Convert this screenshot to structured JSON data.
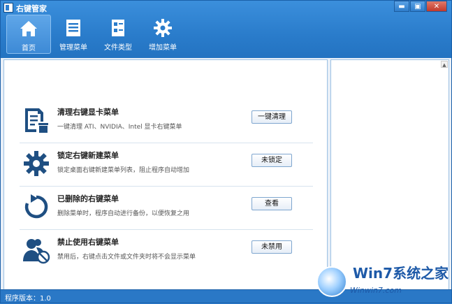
{
  "window": {
    "title": "右键管家",
    "min": "▬",
    "max": "▣",
    "close": "✕"
  },
  "nav": [
    {
      "label": "首页",
      "icon": "home-icon"
    },
    {
      "label": "管理菜单",
      "icon": "list-icon"
    },
    {
      "label": "文件类型",
      "icon": "file-type-icon"
    },
    {
      "label": "增加菜单",
      "icon": "gear-icon"
    }
  ],
  "rows": [
    {
      "title": "清理右键显卡菜单",
      "desc": "一键清理 ATI、NVIDIA、Intel 显卡右键菜单",
      "button": "一键清理",
      "icon": "clean-document-icon"
    },
    {
      "title": "锁定右键新建菜单",
      "desc": "锁定桌面右键新建菜单列表，阻止程序自动增加",
      "button": "未锁定",
      "icon": "gear-icon"
    },
    {
      "title": "已删除的右键菜单",
      "desc": "删除菜单时，程序自动进行备份，以便恢复之用",
      "button": "查看",
      "icon": "restore-arrow-icon"
    },
    {
      "title": "禁止使用右键菜单",
      "desc": "禁用后，右键点击文件或文件夹时将不会显示菜单",
      "button": "未禁用",
      "icon": "user-disabled-icon"
    }
  ],
  "status": {
    "version": "程序版本：1.0"
  },
  "watermark": {
    "line1": "Win7系统之家",
    "line2": "Winwin7.com"
  },
  "colors": {
    "accent": "#2a7ccb",
    "icon": "#1f4f82"
  }
}
